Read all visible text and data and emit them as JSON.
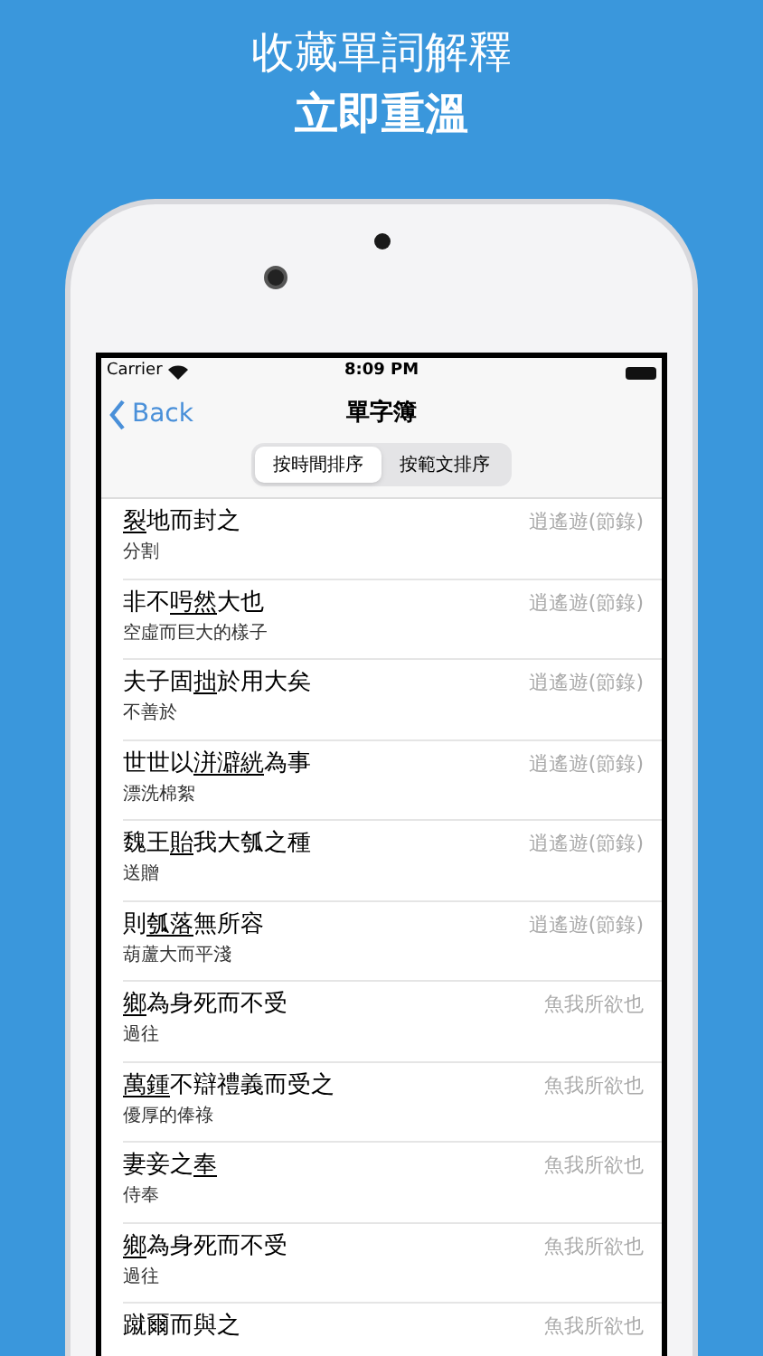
{
  "headline": [
    "收藏單詞解釋",
    "立即重溫"
  ],
  "status_bar": {
    "carrier": "Carrier",
    "time": "8:09 PM"
  },
  "nav": {
    "back": "Back",
    "title": "單字簿"
  },
  "segments": [
    {
      "label": "按時間排序",
      "selected": true
    },
    {
      "label": "按範文排序",
      "selected": false
    }
  ],
  "rows": [
    {
      "phrase": [
        {
          "text": "裂",
          "underlined": true
        },
        {
          "text": "地而封之",
          "underlined": false
        }
      ],
      "meaning": "分割",
      "source": "逍遙遊(節錄)"
    },
    {
      "phrase": [
        {
          "text": "非不",
          "underlined": false
        },
        {
          "text": "呺然",
          "underlined": true
        },
        {
          "text": "大也",
          "underlined": false
        }
      ],
      "meaning": "空虛而巨大的樣子",
      "source": "逍遙遊(節錄)"
    },
    {
      "phrase": [
        {
          "text": "夫子固",
          "underlined": false
        },
        {
          "text": "拙",
          "underlined": true
        },
        {
          "text": "於用大矣",
          "underlined": false
        }
      ],
      "meaning": "不善於",
      "source": "逍遙遊(節錄)"
    },
    {
      "phrase": [
        {
          "text": "世世以",
          "underlined": false
        },
        {
          "text": "洴澼絖",
          "underlined": true
        },
        {
          "text": "為事",
          "underlined": false
        }
      ],
      "meaning": "漂洗棉絮",
      "source": "逍遙遊(節錄)"
    },
    {
      "phrase": [
        {
          "text": "魏王",
          "underlined": false
        },
        {
          "text": "貽",
          "underlined": true
        },
        {
          "text": "我大瓠之種",
          "underlined": false
        }
      ],
      "meaning": "送贈",
      "source": "逍遙遊(節錄)"
    },
    {
      "phrase": [
        {
          "text": "則",
          "underlined": false
        },
        {
          "text": "瓠落",
          "underlined": true
        },
        {
          "text": "無所容",
          "underlined": false
        }
      ],
      "meaning": "葫蘆大而平淺",
      "source": "逍遙遊(節錄)"
    },
    {
      "phrase": [
        {
          "text": "鄉",
          "underlined": true
        },
        {
          "text": "為身死而不受",
          "underlined": false
        }
      ],
      "meaning": "過往",
      "source": "魚我所欲也"
    },
    {
      "phrase": [
        {
          "text": "萬鍾",
          "underlined": true
        },
        {
          "text": "不辯禮義而受之",
          "underlined": false
        }
      ],
      "meaning": "優厚的俸祿",
      "source": "魚我所欲也"
    },
    {
      "phrase": [
        {
          "text": "妻妾之",
          "underlined": false
        },
        {
          "text": "奉",
          "underlined": true
        }
      ],
      "meaning": "侍奉",
      "source": "魚我所欲也"
    },
    {
      "phrase": [
        {
          "text": "鄉",
          "underlined": true
        },
        {
          "text": "為身死而不受",
          "underlined": false
        }
      ],
      "meaning": "過往",
      "source": "魚我所欲也"
    },
    {
      "phrase": [
        {
          "text": "蹴爾而與之",
          "underlined": false
        }
      ],
      "source": "魚我所欲也"
    }
  ]
}
